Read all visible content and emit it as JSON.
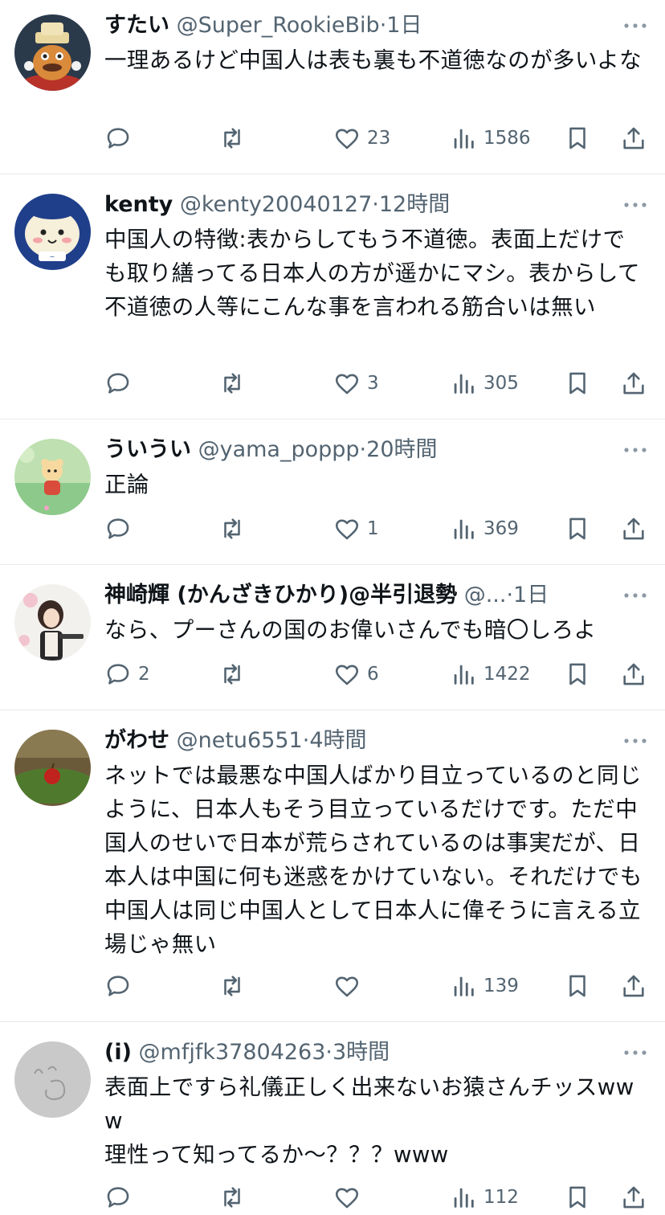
{
  "icons": {
    "reply": "reply-icon",
    "retweet": "retweet-icon",
    "like": "heart-icon",
    "views": "views-icon",
    "bookmark": "bookmark-icon",
    "share": "share-icon",
    "more": "more-icon"
  },
  "colors": {
    "text": "#0f1419",
    "secondary": "#536471",
    "divider": "#e7e9ea"
  },
  "tweets": [
    {
      "name": "すたい",
      "handle": "@Super_RookieBib",
      "sep": "·",
      "time": "1日",
      "text": "一理あるけど中国人は表も裏も不道徳なのが多いよな",
      "reply_count": "",
      "retweet_count": "",
      "like_count": "23",
      "view_count": "1586"
    },
    {
      "name": "kenty",
      "handle": "@kenty20040127",
      "sep": "·",
      "time": "12時間",
      "text": "中国人の特徴:表からしてもう不道徳。表面上だけでも取り繕ってる日本人の方が遥かにマシ。表からして不道徳の人等にこんな事を言われる筋合いは無い",
      "reply_count": "",
      "retweet_count": "",
      "like_count": "3",
      "view_count": "305"
    },
    {
      "name": "ういうい",
      "handle": "@yama_poppp",
      "sep": "·",
      "time": "20時間",
      "text": "正論",
      "reply_count": "",
      "retweet_count": "",
      "like_count": "1",
      "view_count": "369"
    },
    {
      "name": "神崎輝 (かんざきひかり)@半引退勢",
      "handle": "@...",
      "sep": "·",
      "time": "1日",
      "text": "なら、プーさんの国のお偉いさんでも暗〇しろよ",
      "reply_count": "2",
      "retweet_count": "",
      "like_count": "6",
      "view_count": "1422"
    },
    {
      "name": "がわせ",
      "handle": "@netu6551",
      "sep": "·",
      "time": "4時間",
      "text": "ネットでは最悪な中国人ばかり目立っているのと同じように、日本人もそう目立っているだけです。ただ中国人のせいで日本が荒らされているのは事実だが、日本人は中国に何も迷惑をかけていない。それだけでも中国人は同じ中国人として日本人に偉そうに言える立場じゃ無い",
      "reply_count": "",
      "retweet_count": "",
      "like_count": "",
      "view_count": "139"
    },
    {
      "name": "(i)",
      "handle": "@mfjfk37804263",
      "sep": "·",
      "time": "3時間",
      "text": "表面上ですら礼儀正しく出来ないお猿さんチッスwww\n理性って知ってるか～？？？www",
      "reply_count": "",
      "retweet_count": "",
      "like_count": "",
      "view_count": "112"
    }
  ]
}
